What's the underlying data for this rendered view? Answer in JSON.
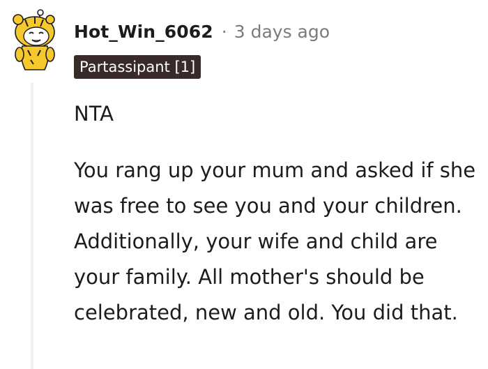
{
  "comment": {
    "author": "Hot_Win_6062",
    "separator": "·",
    "timestamp": "3 days ago",
    "flair": "Partassipant [1]",
    "paragraphs": [
      "NTA",
      "You rang up your mum and asked if she was free to see you and your children. Additionally, your wife and child are your family. All mother's should be celebrated, new and old. You did that."
    ]
  },
  "colors": {
    "flair_bg": "#3b2a2a",
    "meta_gray": "#787c7e",
    "thread_line": "#edeff1",
    "avatar_yellow": "#f5c82d"
  },
  "icons": {
    "avatar": "snoo-tiger-avatar-icon"
  }
}
